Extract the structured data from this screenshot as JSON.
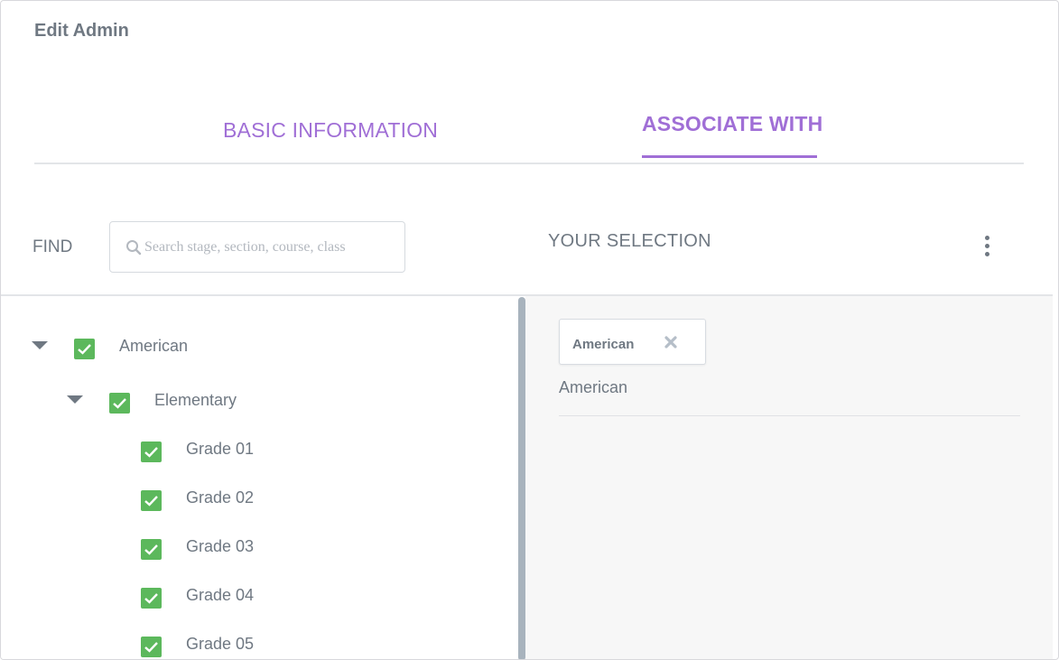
{
  "dialog": {
    "title": "Edit Admin"
  },
  "tabs": [
    {
      "label": "BASIC INFORMATION",
      "active": false
    },
    {
      "label": "ASSOCIATE WITH",
      "active": true
    }
  ],
  "find": {
    "label": "FIND",
    "placeholder": "Search stage, section, course, class",
    "value": ""
  },
  "selection_panel": {
    "title": "YOUR SELECTION",
    "chips": [
      {
        "label": "American"
      }
    ],
    "path": "American"
  },
  "tree": {
    "stage": {
      "label": "American",
      "checked": true,
      "expanded": true
    },
    "section": {
      "label": "Elementary",
      "checked": true,
      "expanded": true
    },
    "grades": [
      {
        "label": "Grade 01",
        "checked": true
      },
      {
        "label": "Grade 02",
        "checked": true
      },
      {
        "label": "Grade 03",
        "checked": true
      },
      {
        "label": "Grade 04",
        "checked": true
      },
      {
        "label": "Grade 05",
        "checked": true
      }
    ]
  },
  "icons": {
    "search": "search-icon",
    "more": "kebab-menu-icon",
    "close": "close-icon",
    "expand": "caret-down-icon",
    "check": "checkbox-checked-icon"
  },
  "colors": {
    "accent": "#a06fd6",
    "checkbox": "#5cb85c",
    "text": "#6f7882",
    "panel_bg": "#f7f7f7"
  }
}
